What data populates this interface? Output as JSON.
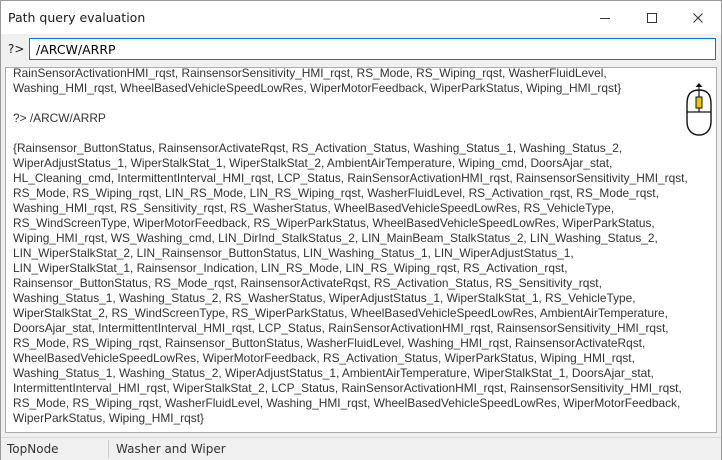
{
  "window": {
    "title": "Path query evaluation"
  },
  "query": {
    "prompt": "?>",
    "value": "/ARCW/ARRP"
  },
  "output": {
    "lines": [
      "RainSensorActivationHMI_rqst, RainsensorSensitivity_HMI_rqst, RS_Mode, RS_Wiping_rqst, WasherFluidLevel, Washing_HMI_rqst, WheelBasedVehicleSpeedLowRes, WiperMotorFeedback, WiperParkStatus, Wiping_HMI_rqst}",
      "",
      "?> /ARCW/ARRP",
      "",
      "{Rainsensor_ButtonStatus, RainsensorActivateRqst, RS_Activation_Status, Washing_Status_1, Washing_Status_2, WiperAdjustStatus_1, WiperStalkStat_1, WiperStalkStat_2, AmbientAirTemperature, Wiping_cmd, DoorsAjar_stat, HL_Cleaning_cmd, IntermittentInterval_HMI_rqst, LCP_Status, RainSensorActivationHMI_rqst, RainsensorSensitivity_HMI_rqst, RS_Mode, RS_Wiping_rqst, LIN_RS_Mode, LIN_RS_Wiping_rqst, WasherFluidLevel, RS_Activation_rqst, RS_Mode_rqst, Washing_HMI_rqst, RS_Sensitivity_rqst, RS_WasherStatus, WheelBasedVehicleSpeedLowRes, RS_VehicleType, RS_WindScreenType, WiperMotorFeedback, RS_WiperParkStatus, WheelBasedVehicleSpeedLowRes, WiperParkStatus, Wiping_HMI_rqst, WS_Washing_cmd, LIN_DirInd_StalkStatus_2, LIN_MainBeam_StalkStatus_2, LIN_Washing_Status_2, LIN_WiperStalkStat_2, LIN_Rainsensor_ButtonStatus, LIN_Washing_Status_1, LIN_WiperAdjustStatus_1, LIN_WiperStalkStat_1, Rainsensor_Indication, LIN_RS_Mode, LIN_RS_Wiping_rqst, RS_Activation_rqst, Rainsensor_ButtonStatus, RS_Mode_rqst, RainsensorActivateRqst, RS_Activation_Status, RS_Sensitivity_rqst, Washing_Status_1, Washing_Status_2, RS_WasherStatus, WiperAdjustStatus_1, WiperStalkStat_1, RS_VehicleType, WiperStalkStat_2, RS_WindScreenType, RS_WiperParkStatus, WheelBasedVehicleSpeedLowRes, AmbientAirTemperature, DoorsAjar_stat, IntermittentInterval_HMI_rqst, LCP_Status, RainSensorActivationHMI_rqst, RainsensorSensitivity_HMI_rqst, RS_Mode, RS_Wiping_rqst, Rainsensor_ButtonStatus, WasherFluidLevel, Washing_HMI_rqst, RainsensorActivateRqst, WheelBasedVehicleSpeedLowRes, WiperMotorFeedback, RS_Activation_Status, WiperParkStatus, Wiping_HMI_rqst, Washing_Status_1, Washing_Status_2, WiperAdjustStatus_1, AmbientAirTemperature, WiperStalkStat_1, DoorsAjar_stat, IntermittentInterval_HMI_rqst, WiperStalkStat_2, LCP_Status, RainSensorActivationHMI_rqst, RainsensorSensitivity_HMI_rqst, RS_Mode, RS_Wiping_rqst, WasherFluidLevel, Washing_HMI_rqst, WheelBasedVehicleSpeedLowRes, WiperMotorFeedback, WiperParkStatus, Wiping_HMI_rqst}"
    ]
  },
  "statusbar": {
    "left": "TopNode",
    "right": "Washer and Wiper"
  },
  "icons": {
    "minimize": "minimize-icon",
    "maximize": "maximize-icon",
    "close": "close-icon",
    "mouse_scroll": "mouse-scroll-icon"
  },
  "colors": {
    "input_border": "#0078d7",
    "mouse_wheel": "#e8c800"
  }
}
